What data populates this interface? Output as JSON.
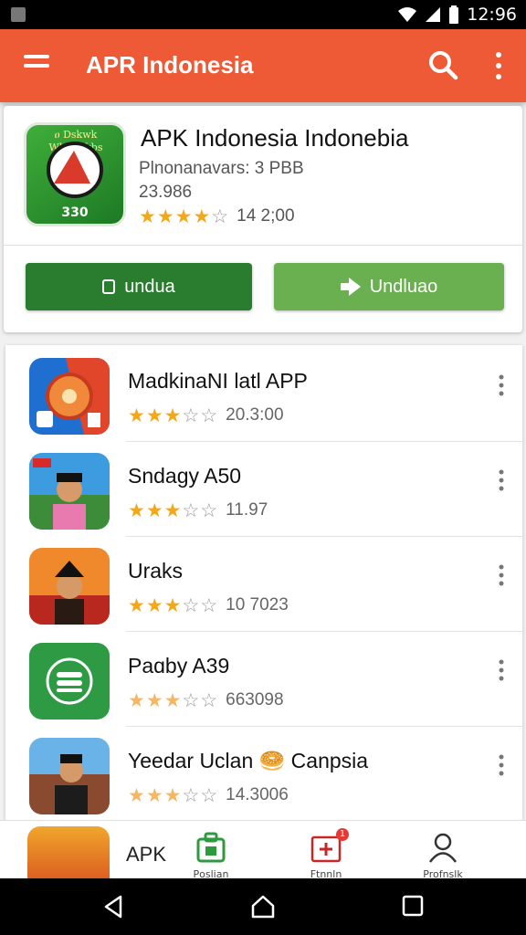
{
  "status": {
    "time": "12:96"
  },
  "appbar": {
    "title": "APR Indonesia"
  },
  "featured": {
    "icon_arc_text": "ዐ Dskwk Wbwarkbs",
    "icon_number": "330",
    "name": "APK Indonesia Indonebia",
    "subtitle": "Plnonanavars: 3 PBB",
    "size": "23.986",
    "stars_filled": 4,
    "rating_text": "14 2;00",
    "primary_button": "undua",
    "secondary_button": "Undluao",
    "colors": {
      "primary": "#2a7d2e",
      "secondary": "#6aaf50"
    }
  },
  "apps": [
    {
      "title": "MadkinaNI latl APP",
      "stars_filled": 3,
      "rating_text": "20.3:00",
      "faded": false
    },
    {
      "title": "Sndagy A50",
      "stars_filled": 3,
      "rating_text": "11.97",
      "faded": false
    },
    {
      "title": "Uraks",
      "stars_filled": 3,
      "rating_text": "10 7023",
      "faded": false
    },
    {
      "title": "Paɑby A39",
      "stars_filled": 3,
      "rating_text": "663098",
      "faded": true
    },
    {
      "title": "Yeedar Uclan 🥯 Canpsia",
      "stars_filled": 3,
      "rating_text": "14.3006",
      "faded": true
    }
  ],
  "bottom": {
    "peek_title": "APK",
    "nav": [
      {
        "label": "Рoslian",
        "icon": "bag-icon"
      },
      {
        "label": "Ftnnln",
        "icon": "first-aid-icon",
        "badge": "1"
      },
      {
        "label": "Profnslk",
        "icon": "profile-icon"
      }
    ]
  },
  "colors": {
    "appbar": "#ee5a36",
    "star": "#f3a71a"
  }
}
